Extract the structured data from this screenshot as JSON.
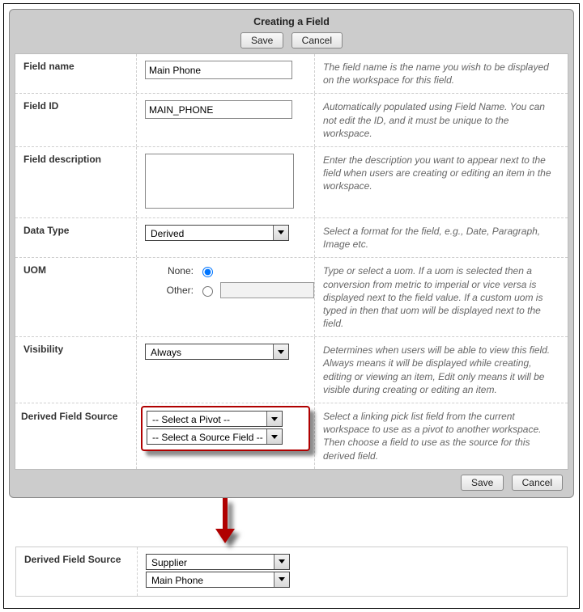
{
  "dialog": {
    "title": "Creating a Field",
    "save_label": "Save",
    "cancel_label": "Cancel"
  },
  "rows": {
    "field_name": {
      "label": "Field name",
      "value": "Main Phone",
      "help": "The field name is the name you wish to be displayed on the workspace for this field."
    },
    "field_id": {
      "label": "Field ID",
      "value": "MAIN_PHONE",
      "help": "Automatically populated using Field Name. You can not edit the ID, and it must be unique to the workspace."
    },
    "description": {
      "label": "Field description",
      "value": "",
      "help": "Enter the description you want to appear next to the field when users are creating or editing an item in the workspace."
    },
    "data_type": {
      "label": "Data Type",
      "value": "Derived",
      "help": "Select a format for the field, e.g., Date, Paragraph, Image etc."
    },
    "uom": {
      "label": "UOM",
      "none_label": "None:",
      "other_label": "Other:",
      "help": "Type or select a uom. If a uom is selected then a conversion from metric to imperial or vice versa is displayed next to the field value. If a custom uom is typed in then that uom will be displayed next to the field."
    },
    "visibility": {
      "label": "Visibility",
      "value": "Always",
      "help": "Determines when users will be able to view this field. Always means it will be displayed while creating, editing or viewing an item, Edit only means it will be visible during creating or editing an item."
    },
    "derived": {
      "label": "Derived Field Source",
      "pivot_value": "-- Select a Pivot --",
      "source_value": "-- Select a Source Field --",
      "help": "Select a linking pick list field from the current workspace to use as a pivot to another workspace. Then choose a field to use as the source for this derived field."
    }
  },
  "after": {
    "label": "Derived Field Source",
    "pivot_value": "Supplier",
    "source_value": "Main Phone"
  }
}
